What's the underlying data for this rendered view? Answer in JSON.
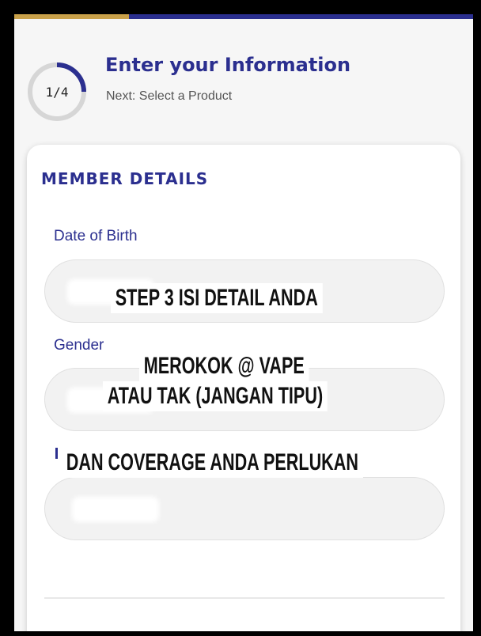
{
  "progress": {
    "fraction": 0.25,
    "accent_color": "#2b2f8f",
    "fill_color": "#c9a14a"
  },
  "step": {
    "count": "1/4",
    "title": "Enter your Information",
    "next": "Next: Select a Product"
  },
  "section": {
    "title": "MEMBER DETAILS"
  },
  "fields": [
    {
      "label": "Date of Birth",
      "value": ""
    },
    {
      "label": "Gender",
      "value": ""
    },
    {
      "label": "",
      "value": ""
    }
  ],
  "overlay": {
    "line1": "STEP 3 ISI DETAIL ANDA",
    "line2": "MEROKOK @ VAPE",
    "line3": "ATAU TAK (JANGAN TIPU)",
    "line4": "DAN COVERAGE ANDA PERLUKAN"
  }
}
